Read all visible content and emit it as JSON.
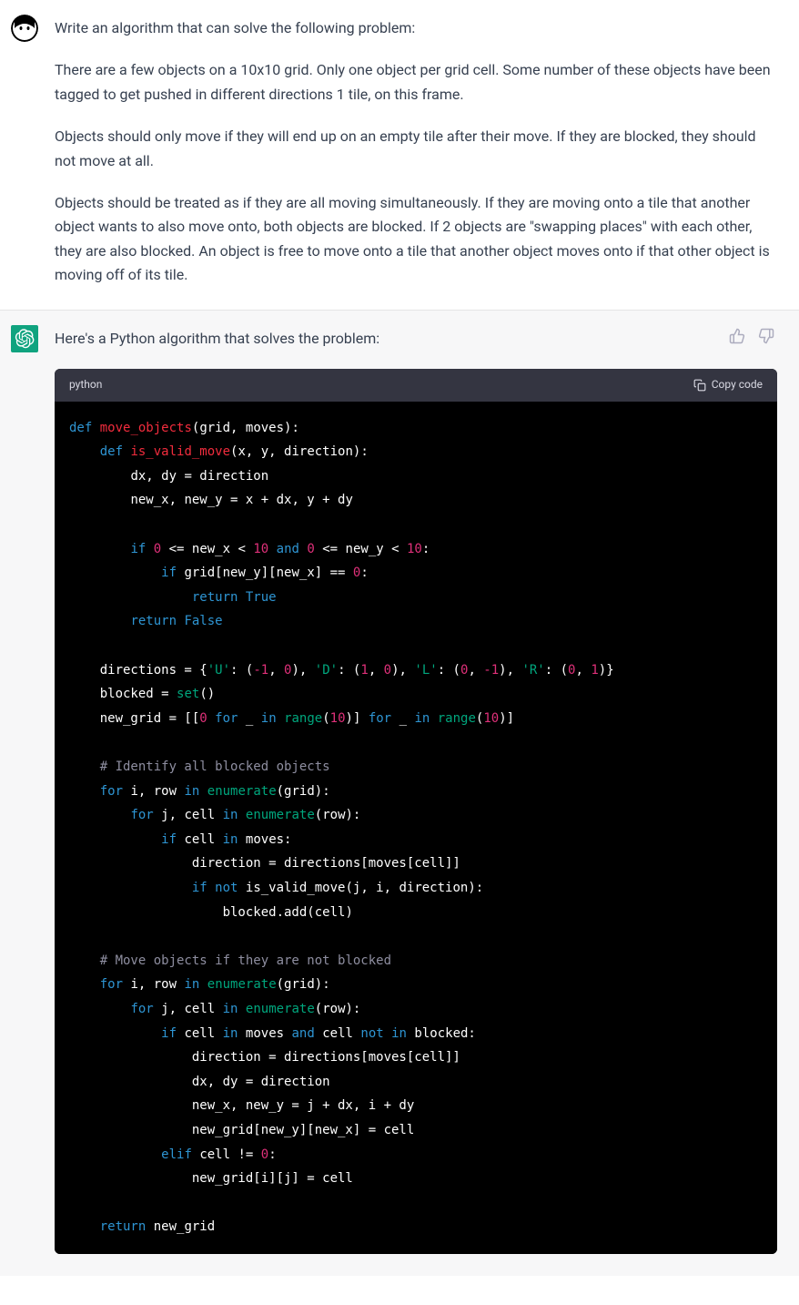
{
  "user": {
    "p1": "Write an algorithm that can solve the following problem:",
    "p2": "There are a few objects on a 10x10 grid. Only one object per grid cell. Some number of these objects have been tagged to get pushed in different directions 1 tile, on this frame.",
    "p3": "Objects should only move if they will end up on an empty tile after their move. If they are blocked, they should not move at all.",
    "p4": "Objects should be treated as if they are all moving simultaneously. If they are moving onto a tile that another object wants to also move onto, both objects are blocked. If 2 objects are \"swapping places\" with each other, they are also blocked. An object is free to move onto a tile that another object moves onto if that other object is moving off of its tile."
  },
  "assistant": {
    "intro": "Here's a Python algorithm that solves the problem:",
    "code_lang": "python",
    "copy_label": "Copy code",
    "code": {
      "l1_def": "def",
      "l1_fn": "move_objects",
      "l1_rest": "(grid, moves):",
      "l2_def": "def",
      "l2_fn": "is_valid_move",
      "l2_rest": "(x, y, direction):",
      "l3": "dx, dy = direction",
      "l4": "new_x, new_y = x + dx, y + dy",
      "l5_if": "if",
      "l5_num0": "0",
      "l5_le": "<= new_x <",
      "l5_num10a": "10",
      "l5_and": "and",
      "l5_num0b": "0",
      "l5_le2": "<= new_y <",
      "l5_num10b": "10",
      "l5_colon": ":",
      "l6_if": "if",
      "l6_expr": "grid[new_y][new_x] ==",
      "l6_zero": "0",
      "l6_colon": ":",
      "l7_return": "return",
      "l7_true": "True",
      "l8_return": "return",
      "l8_false": "False",
      "l9_pre": "directions = {",
      "l9_u": "'U'",
      "l9_c1": ": (",
      "l9_n1": "-1",
      "l9_c1b": ", ",
      "l9_n2": "0",
      "l9_c1c": "), ",
      "l9_d": "'D'",
      "l9_c2": ": (",
      "l9_n3": "1",
      "l9_c2b": ", ",
      "l9_n4": "0",
      "l9_c2c": "), ",
      "l9_l": "'L'",
      "l9_c3": ": (",
      "l9_n5": "0",
      "l9_c3b": ", ",
      "l9_n6": "-1",
      "l9_c3c": "), ",
      "l9_r": "'R'",
      "l9_c4": ": (",
      "l9_n7": "0",
      "l9_c4b": ", ",
      "l9_n8": "1",
      "l9_c4c": ")}",
      "l10_pre": "blocked = ",
      "l10_set": "set",
      "l10_post": "()",
      "l11_pre": "new_grid = [[",
      "l11_zero": "0",
      "l11_for1": "for",
      "l11_u1": "_",
      "l11_in1": "in",
      "l11_range1": "range",
      "l11_r1": "(",
      "l11_ten1": "10",
      "l11_r1b": ")]",
      "l11_for2": "for",
      "l11_u2": "_",
      "l11_in2": "in",
      "l11_range2": "range",
      "l11_r2": "(",
      "l11_ten2": "10",
      "l11_r2b": ")]",
      "c1": "# Identify all blocked objects",
      "l12_for": "for",
      "l12_i": "i, row",
      "l12_in": "in",
      "l12_enum": "enumerate",
      "l12_rest": "(grid):",
      "l13_for": "for",
      "l13_j": "j, cell",
      "l13_in": "in",
      "l13_enum": "enumerate",
      "l13_rest": "(row):",
      "l14_if": "if",
      "l14_cell": "cell",
      "l14_in": "in",
      "l14_moves": "moves:",
      "l15": "direction = directions[moves[cell]]",
      "l16_if": "if",
      "l16_not": "not",
      "l16_rest": "is_valid_move(j, i, direction):",
      "l17": "blocked.add(cell)",
      "c2": "# Move objects if they are not blocked",
      "l18_for": "for",
      "l18_i": "i, row",
      "l18_in": "in",
      "l18_enum": "enumerate",
      "l18_rest": "(grid):",
      "l19_for": "for",
      "l19_j": "j, cell",
      "l19_in": "in",
      "l19_enum": "enumerate",
      "l19_rest": "(row):",
      "l20_if": "if",
      "l20_cell": "cell",
      "l20_in": "in",
      "l20_moves": "moves",
      "l20_and": "and",
      "l20_cell2": "cell",
      "l20_not": "not",
      "l20_in2": "in",
      "l20_blocked": "blocked:",
      "l21": "direction = directions[moves[cell]]",
      "l22": "dx, dy = direction",
      "l23": "new_x, new_y = j + dx, i + dy",
      "l24": "new_grid[new_y][new_x] = cell",
      "l25_elif": "elif",
      "l25_cell": "cell !=",
      "l25_zero": "0",
      "l25_colon": ":",
      "l26": "new_grid[i][j] = cell",
      "l27_return": "return",
      "l27_ng": "new_grid"
    }
  }
}
